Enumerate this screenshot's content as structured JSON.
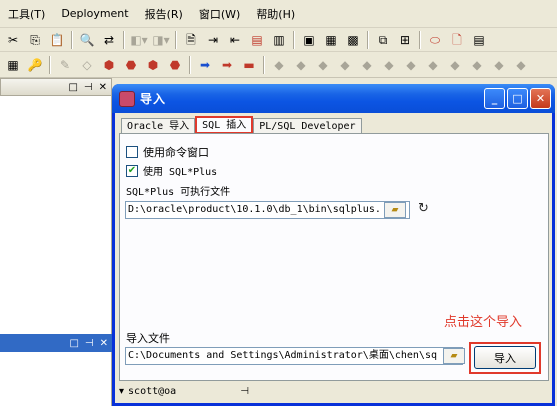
{
  "menu": [
    "工具(T)",
    "Deployment",
    "报告(R)",
    "窗口(W)",
    "帮助(H)"
  ],
  "toolbar1_icons": [
    "cut-icon",
    "copy-icon",
    "paste-icon",
    "find-icon",
    "replace-icon",
    "nav-back-icon",
    "nav-forward-icon",
    "document-icon",
    "indent-icon",
    "unindent-icon",
    "comment-icon",
    "uncomment-icon",
    "window-icon",
    "tile-icon",
    "cascade-icon",
    "stop-icon",
    "pdf-icon",
    "properties-icon"
  ],
  "dialog": {
    "title": "导入",
    "tabs": [
      "Oracle 导入",
      "SQL 插入",
      "PL/SQL Developer"
    ],
    "active_tab": "SQL 插入",
    "checkbox_cmd_window": "使用命令窗口",
    "checkbox_cmd_window_checked": false,
    "checkbox_sqlplus": "使用 SQL*Plus",
    "checkbox_sqlplus_checked": true,
    "sqlplus_exe_label": "SQL*Plus 可执行文件",
    "sqlplus_path": "D:\\oracle\\product\\10.1.0\\db_1\\bin\\sqlplus.",
    "annotation": "点击这个导入",
    "import_file_label": "导入文件",
    "import_file_path": "C:\\Documents and Settings\\Administrator\\桌面\\chen\\sq",
    "import_button": "导入",
    "connection": "scott@oa"
  },
  "accent_color": "#0a4ed8",
  "highlight_color": "#e0392b"
}
